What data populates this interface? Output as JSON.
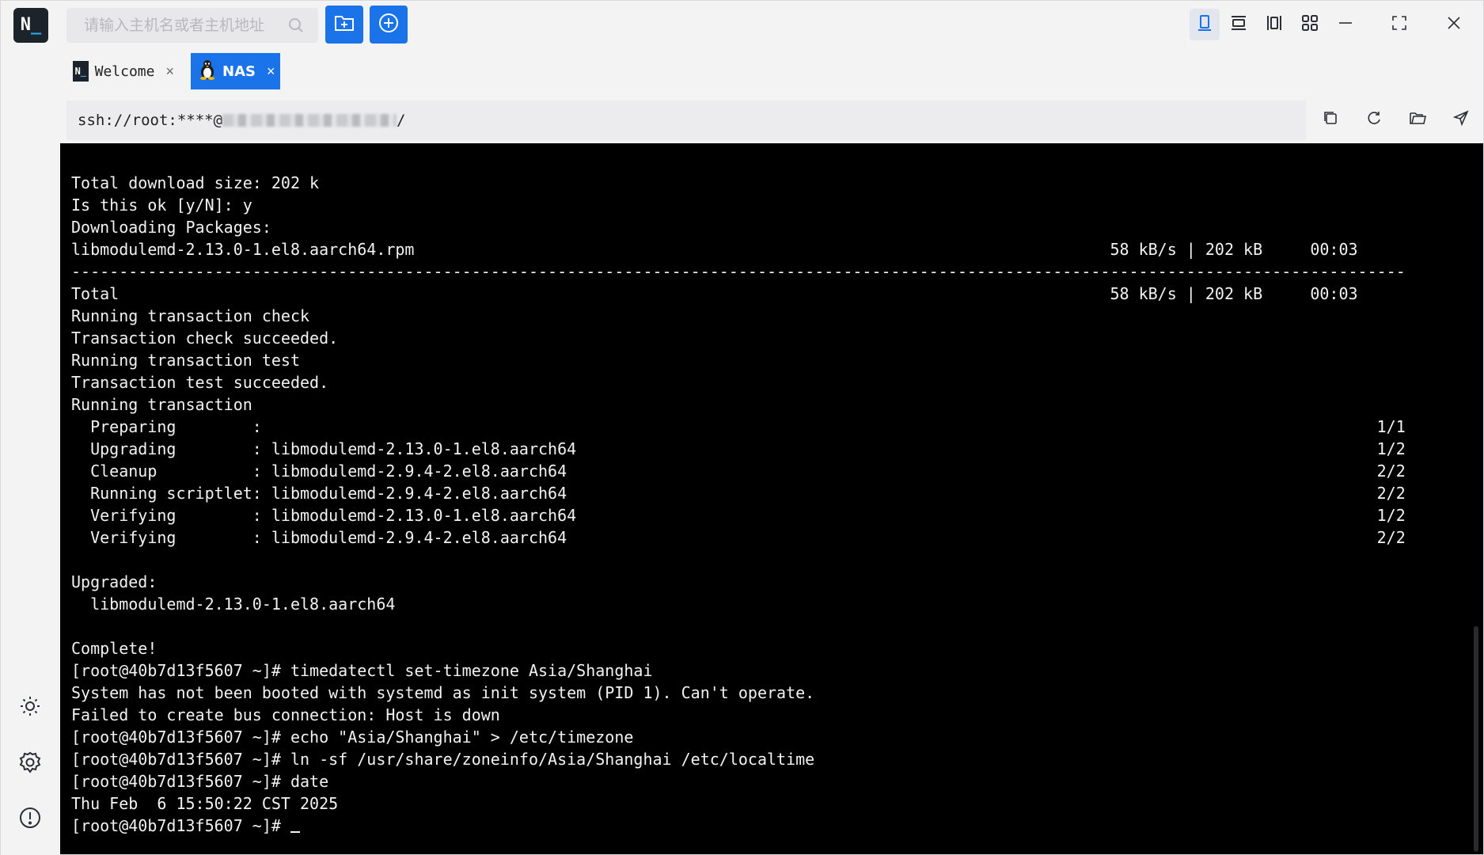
{
  "app": {
    "logo_main": "N",
    "logo_accent": "_"
  },
  "search": {
    "placeholder": "请输入主机名或者主机地址"
  },
  "tabs": [
    {
      "label": "Welcome",
      "close": "×"
    },
    {
      "label": "NAS",
      "close": "×"
    }
  ],
  "address": {
    "prefix": "ssh://root:****@",
    "suffix": "/"
  },
  "colors": {
    "accent": "#1a73e8",
    "terminal_bg": "#000000",
    "terminal_fg": "#f2f2f2",
    "logo_bg": "#1c232b"
  },
  "icons": [
    "search-icon",
    "new-folder-icon",
    "add-icon",
    "layout-single-icon",
    "layout-rows-icon",
    "layout-columns-icon",
    "layout-grid-icon",
    "minimize-icon",
    "maximize-icon",
    "close-icon",
    "copy-icon",
    "refresh-icon",
    "folder-icon",
    "send-icon",
    "theme-icon",
    "settings-icon",
    "info-icon",
    "linux-icon"
  ],
  "terminal": {
    "lines": [
      "Total download size: 202 k",
      "Is this ok [y/N]: y",
      "Downloading Packages:",
      "libmodulemd-2.13.0-1.el8.aarch64.rpm                                                                         58 kB/s | 202 kB     00:03",
      "--------------------------------------------------------------------------------------------------------------------------------------------",
      "Total                                                                                                        58 kB/s | 202 kB     00:03",
      "Running transaction check",
      "Transaction check succeeded.",
      "Running transaction test",
      "Transaction test succeeded.",
      "Running transaction",
      "  Preparing        :                                                                                                                     1/1",
      "  Upgrading        : libmodulemd-2.13.0-1.el8.aarch64                                                                                    1/2",
      "  Cleanup          : libmodulemd-2.9.4-2.el8.aarch64                                                                                     2/2",
      "  Running scriptlet: libmodulemd-2.9.4-2.el8.aarch64                                                                                     2/2",
      "  Verifying        : libmodulemd-2.13.0-1.el8.aarch64                                                                                    1/2",
      "  Verifying        : libmodulemd-2.9.4-2.el8.aarch64                                                                                     2/2",
      "",
      "Upgraded:",
      "  libmodulemd-2.13.0-1.el8.aarch64",
      "",
      "Complete!",
      "[root@40b7d13f5607 ~]# timedatectl set-timezone Asia/Shanghai",
      "System has not been booted with systemd as init system (PID 1). Can't operate.",
      "Failed to create bus connection: Host is down",
      "[root@40b7d13f5607 ~]# echo \"Asia/Shanghai\" > /etc/timezone",
      "[root@40b7d13f5607 ~]# ln -sf /usr/share/zoneinfo/Asia/Shanghai /etc/localtime",
      "[root@40b7d13f5607 ~]# date",
      "Thu Feb  6 15:50:22 CST 2025"
    ],
    "prompt": "[root@40b7d13f5607 ~]# "
  }
}
